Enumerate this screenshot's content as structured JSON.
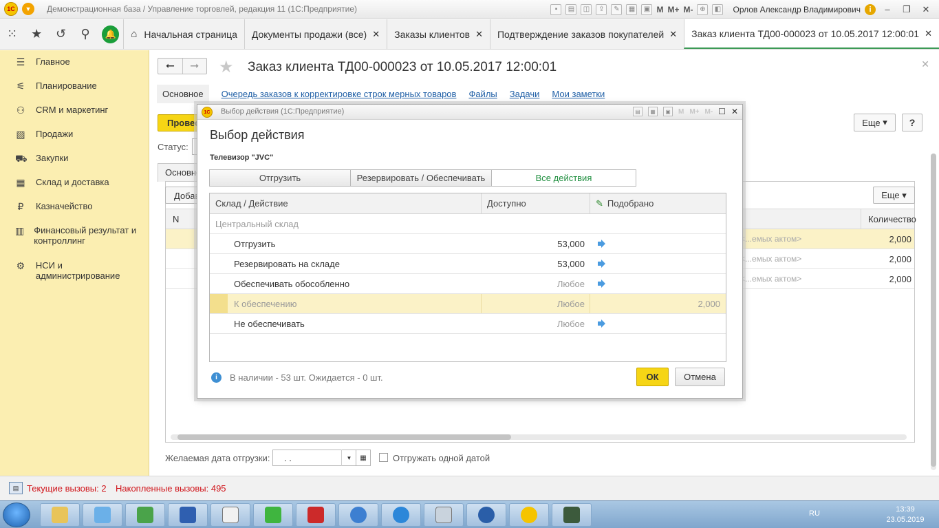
{
  "window": {
    "title": "Демонстрационная база / Управление торговлей, редакция 11  (1С:Предприятие)",
    "user": "Орлов Александр Владимирович",
    "m_labels": [
      "M",
      "M+",
      "M-"
    ]
  },
  "tabs": [
    {
      "label": "Начальная страница"
    },
    {
      "label": "Документы продажи (все)"
    },
    {
      "label": "Заказы клиентов"
    },
    {
      "label": "Подтверждение заказов покупателей"
    },
    {
      "label": "Заказ клиента ТД00-000023 от 10.05.2017 12:00:01"
    }
  ],
  "sidebar": {
    "items": [
      {
        "label": "Главное",
        "icon": "menu-icon"
      },
      {
        "label": "Планирование",
        "icon": "planning-icon"
      },
      {
        "label": "CRM и маркетинг",
        "icon": "crm-icon"
      },
      {
        "label": "Продажи",
        "icon": "cart-icon"
      },
      {
        "label": "Закупки",
        "icon": "truck-icon"
      },
      {
        "label": "Склад и доставка",
        "icon": "warehouse-icon"
      },
      {
        "label": "Казначейство",
        "icon": "ruble-icon"
      },
      {
        "label": "Финансовый результат и контроллинг",
        "icon": "chart-icon"
      },
      {
        "label": "НСИ и администрирование",
        "icon": "gear-icon"
      }
    ]
  },
  "document": {
    "title": "Заказ клиента ТД00-000023 от 10.05.2017 12:00:01",
    "subnav": {
      "current": "Основное",
      "links": [
        "Очередь заказов к корректировке строк мерных товаров",
        "Файлы",
        "Задачи",
        "Мои заметки"
      ]
    },
    "post_button": "Провести",
    "status_label": "Статус:",
    "inner_tab": "Основное",
    "add_button": "Добавить",
    "more_label": "Еще",
    "help_label": "?",
    "table": {
      "col_n": "N",
      "col_qty": "Количество",
      "rows": [
        {
          "action": "<...емых актом>",
          "qty": "2,000"
        },
        {
          "action": "<...емых актом>",
          "qty": "2,000"
        },
        {
          "action": "<...емых актом>",
          "qty": "2,000"
        }
      ]
    },
    "ship_date_label": "Желаемая дата отгрузки:",
    "ship_date_value": ". .",
    "ship_one_date_label": "Отгружать одной датой"
  },
  "status": {
    "current_calls": "Текущие вызовы: 2",
    "accumulated_calls": "Накопленные вызовы: 495"
  },
  "taskbar": {
    "lang": "RU",
    "time": "13:39",
    "date": "23.05.2019"
  },
  "modal": {
    "window_title": "Выбор действия  (1С:Предприятие)",
    "heading": "Выбор действия",
    "product": "Телевизор \"JVC\"",
    "segments": [
      "Отгрузить",
      "Резервировать / Обеспечивать",
      "Все действия"
    ],
    "grid": {
      "col1": "Склад / Действие",
      "col2": "Доступно",
      "col3": "Подобрано",
      "group": "Центральный склад",
      "rows": [
        {
          "action": "Отгрузить",
          "available": "53,000",
          "picked": ""
        },
        {
          "action": "Резервировать на складе",
          "available": "53,000",
          "picked": ""
        },
        {
          "action": "Обеспечивать обособленно",
          "available": "Любое",
          "picked": ""
        },
        {
          "action": "К обеспечению",
          "available": "Любое",
          "picked": "2,000"
        },
        {
          "action": "Не обеспечивать",
          "available": "Любое",
          "picked": ""
        }
      ]
    },
    "info": "В наличии - 53 шт. Ожидается - 0 шт.",
    "ok": "ОК",
    "cancel": "Отмена"
  },
  "colors": {
    "accent_yellow": "#f6d515",
    "sidebar_bg": "#fbeeb1",
    "link_blue": "#1f5fa6",
    "green": "#1e8e3e",
    "error_red": "#d0141a"
  }
}
